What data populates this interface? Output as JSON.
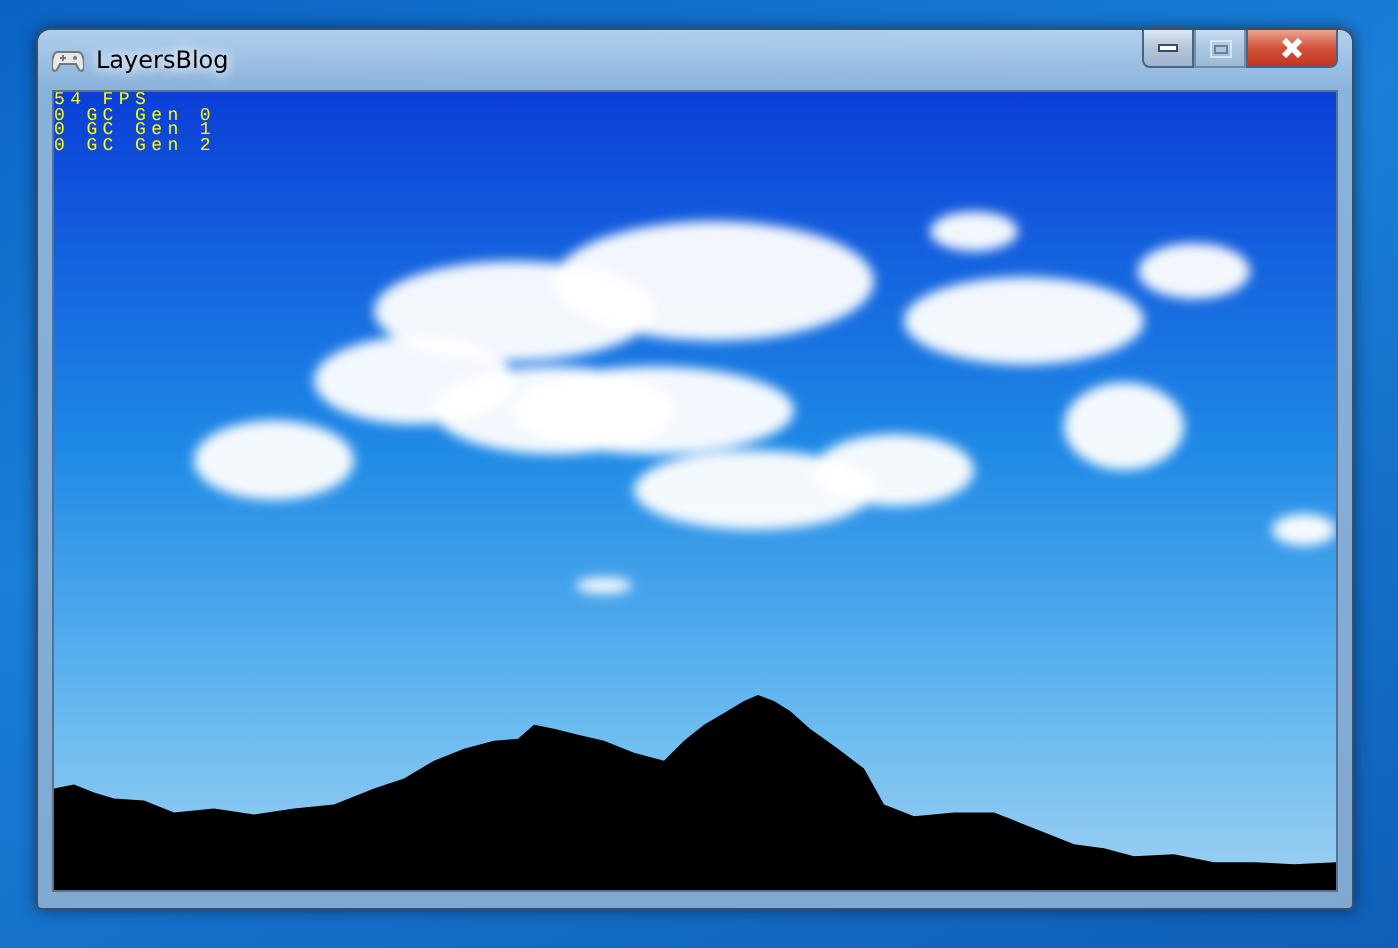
{
  "window": {
    "title": "LayersBlog",
    "controls": [
      {
        "kind": "minimize",
        "disabled": false
      },
      {
        "kind": "maximize",
        "disabled": true
      },
      {
        "kind": "close",
        "disabled": false
      }
    ]
  },
  "game_view": {
    "overlay_lines": [
      "54 FPS",
      "0 GC Gen 0",
      "0 GC Gen 1",
      "0 GC Gen 2"
    ]
  }
}
